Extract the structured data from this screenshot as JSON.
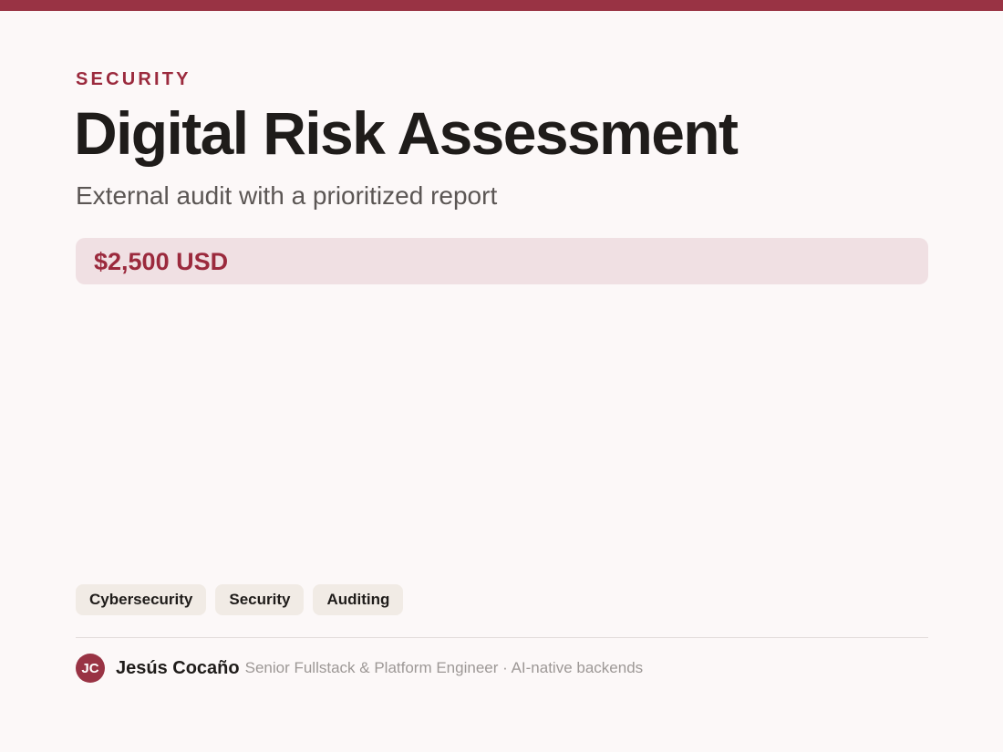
{
  "colors": {
    "accent": "#993344",
    "accent_text": "#9b2a3d",
    "background": "#fcf8f8",
    "price_background": "#f0e0e3",
    "tag_background": "#f1ebe5",
    "heading_text": "#1f1c1a",
    "muted_text": "#9d9896"
  },
  "service": {
    "category": "SECURITY",
    "title": "Digital Risk Assessment",
    "subtitle": "External audit with a prioritized report",
    "price": "$2,500 USD"
  },
  "tags": [
    "Cybersecurity",
    "Security",
    "Auditing"
  ],
  "author": {
    "initials": "JC",
    "name": "Jesús Cocaño",
    "role": "Senior Fullstack & Platform Engineer · AI-native backends"
  }
}
